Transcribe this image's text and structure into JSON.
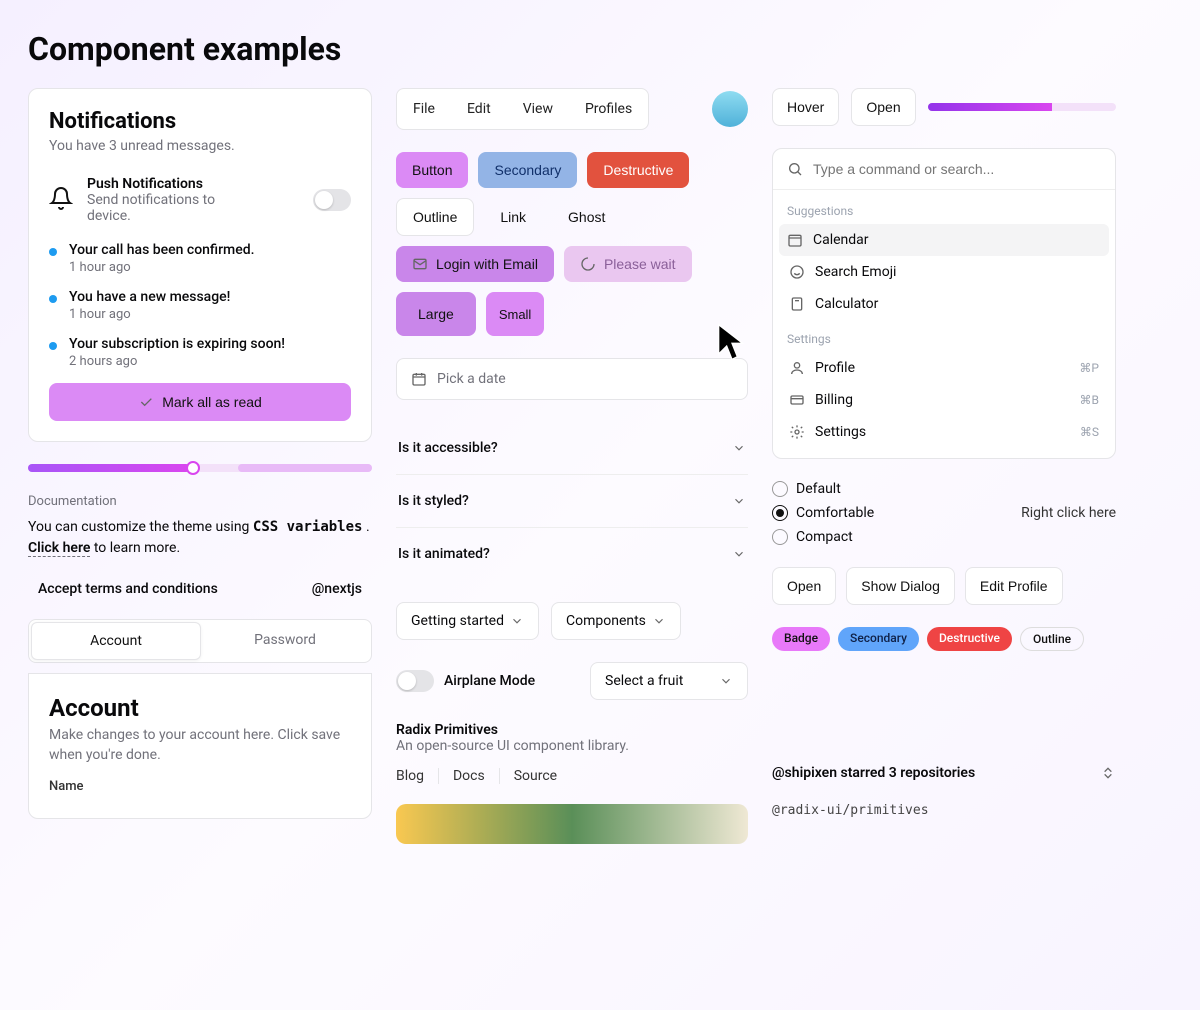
{
  "page_title": "Component examples",
  "notifications": {
    "title": "Notifications",
    "subtitle": "You have 3 unread messages.",
    "push_title": "Push Notifications",
    "push_sub": "Send notifications to device.",
    "items": [
      {
        "text": "Your call has been confirmed.",
        "time": "1 hour ago"
      },
      {
        "text": "You have a new message!",
        "time": "1 hour ago"
      },
      {
        "text": "Your subscription is expiring soon!",
        "time": "2 hours ago"
      }
    ],
    "mark_all": "Mark all as read"
  },
  "progress_left_pct": 47,
  "doc": {
    "heading": "Documentation",
    "text_pre": "You can customize the theme using ",
    "code": "CSS variables",
    "text_post": " . ",
    "click": "Click here",
    "text_tail": " to learn more."
  },
  "terms_label": "Accept terms and conditions",
  "handle": "@nextjs",
  "tabs": {
    "account": "Account",
    "password": "Password"
  },
  "account_card": {
    "title": "Account",
    "sub": "Make changes to your account here. Click save when you're done.",
    "name_label": "Name"
  },
  "menubar": {
    "items": [
      "File",
      "Edit",
      "View",
      "Profiles"
    ]
  },
  "buttons": {
    "primary": "Button",
    "secondary": "Secondary",
    "destructive": "Destructive",
    "outline": "Outline",
    "link": "Link",
    "ghost": "Ghost",
    "login_mail": "Login with Email",
    "please_wait": "Please wait",
    "large": "Large",
    "small": "Small"
  },
  "date_placeholder": "Pick a date",
  "accordion": [
    "Is it accessible?",
    "Is it styled?",
    "Is it animated?"
  ],
  "dropdowns": {
    "getting_started": "Getting started",
    "components": "Components"
  },
  "airplane": "Airplane Mode",
  "select_fruit": "Select a fruit",
  "radix": {
    "title": "Radix Primitives",
    "sub": "An open-source UI component library.",
    "links": [
      "Blog",
      "Docs",
      "Source"
    ]
  },
  "hover": "Hover",
  "open": "Open",
  "progress_right_pct": 66,
  "command": {
    "placeholder": "Type a command or search...",
    "suggestions_h": "Suggestions",
    "settings_h": "Settings",
    "suggestions": [
      "Calendar",
      "Search Emoji",
      "Calculator"
    ],
    "settings": [
      {
        "label": "Profile",
        "shortcut": "⌘P"
      },
      {
        "label": "Billing",
        "shortcut": "⌘B"
      },
      {
        "label": "Settings",
        "shortcut": "⌘S"
      }
    ]
  },
  "radios": [
    "Default",
    "Comfortable",
    "Compact"
  ],
  "radio_selected": 1,
  "right_click": "Right click here",
  "action_buttons": [
    "Open",
    "Show Dialog",
    "Edit Profile"
  ],
  "badges": [
    "Badge",
    "Secondary",
    "Destructive",
    "Outline"
  ],
  "starred": "@shipixen starred 3 repositories",
  "repo": "@radix-ui/primitives"
}
